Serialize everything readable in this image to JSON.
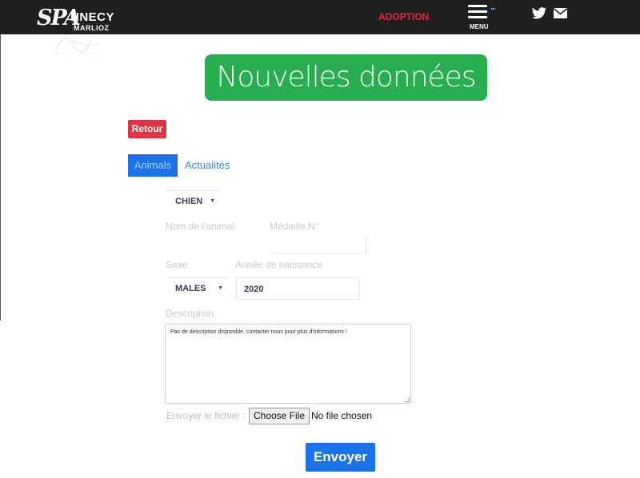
{
  "header": {
    "logo": {
      "part1": "SPA",
      "part2": "NNECY",
      "part3": "MARLIOZ"
    },
    "nav_adoption": "ADOPTION",
    "menu_label": "MENU",
    "icons": [
      "twitter-icon",
      "mail-icon",
      "hamburger-icon"
    ]
  },
  "page": {
    "title": "Nouvelles données"
  },
  "back_button": "Retour",
  "tabs": [
    {
      "label": "Animals",
      "active": true
    },
    {
      "label": "Actualités",
      "active": false
    }
  ],
  "form": {
    "species": {
      "value": "CHIEN"
    },
    "name_label": "Nom de l'animal",
    "medal_label": "Médaille N°",
    "medal_value": "",
    "sex_label": "Sexe",
    "sex": {
      "value": "MALES"
    },
    "year_label": "Année de naissance",
    "year_value": "2020",
    "description_label": "Description",
    "description_value": "Pas de description disponible, contacter nous pour plus d'informations !",
    "file_label": "Envoyer le fichier :",
    "file_button": "Choose File",
    "file_status": "No file chosen",
    "submit_label": "Envoyer"
  },
  "colors": {
    "topbar": "#1f1f1f",
    "accent_red": "#e8263a",
    "banner_green": "#27ae4f",
    "retour_red": "#dc3545",
    "primary_blue": "#1a73e8"
  }
}
